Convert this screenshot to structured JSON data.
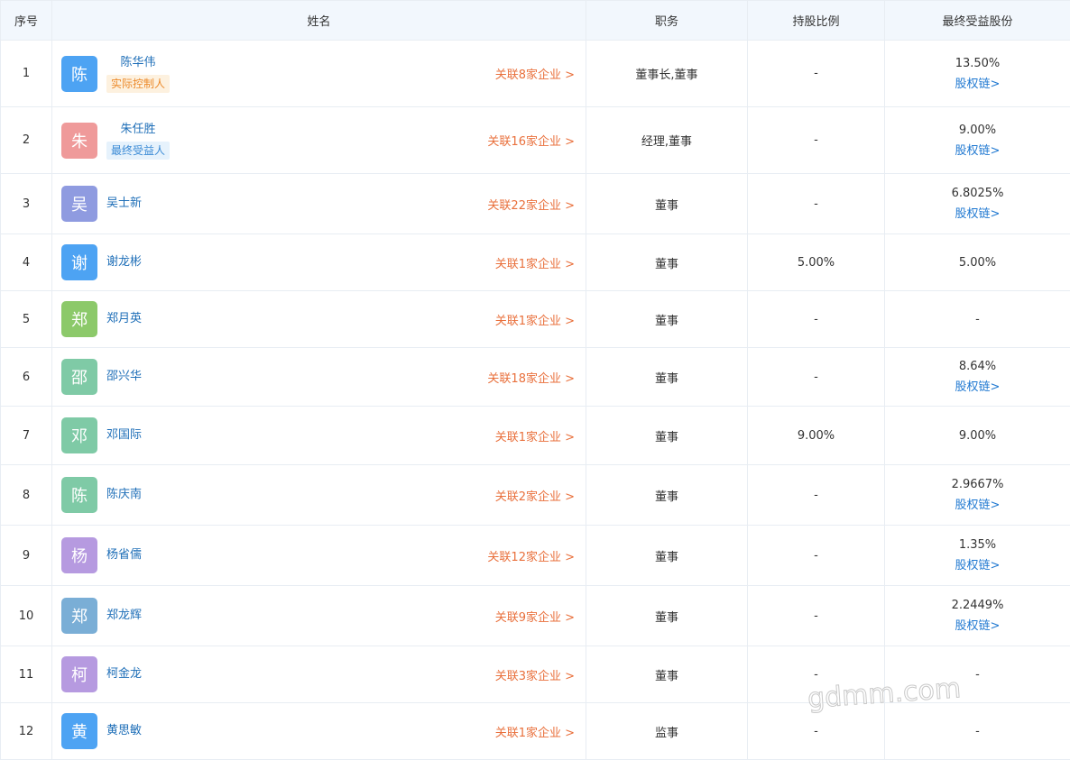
{
  "header": {
    "index": "序号",
    "name": "姓名",
    "position": "职务",
    "share_ratio": "持股比例",
    "ultimate_share": "最终受益股份"
  },
  "rows": [
    {
      "index": "1",
      "avatar_char": "陈",
      "avatar_color": "#4da3f3",
      "name": "陈华伟",
      "tag": "实际控制人",
      "tag_type": "controller",
      "related": "关联8家企业 >",
      "position": "董事长,董事",
      "share_ratio": "-",
      "ultimate_share": "13.50%",
      "chain": "股权链>"
    },
    {
      "index": "2",
      "avatar_char": "朱",
      "avatar_color": "#ef9a9a",
      "name": "朱任胜",
      "tag": "最终受益人",
      "tag_type": "beneficiary",
      "related": "关联16家企业 >",
      "position": "经理,董事",
      "share_ratio": "-",
      "ultimate_share": "9.00%",
      "chain": "股权链>"
    },
    {
      "index": "3",
      "avatar_char": "吴",
      "avatar_color": "#8f9be0",
      "name": "吴士新",
      "tag": "",
      "tag_type": "",
      "related": "关联22家企业 >",
      "position": "董事",
      "share_ratio": "-",
      "ultimate_share": "6.8025%",
      "chain": "股权链>"
    },
    {
      "index": "4",
      "avatar_char": "谢",
      "avatar_color": "#4da3f3",
      "name": "谢龙彬",
      "tag": "",
      "tag_type": "",
      "related": "关联1家企业 >",
      "position": "董事",
      "share_ratio": "5.00%",
      "ultimate_share": "5.00%",
      "chain": ""
    },
    {
      "index": "5",
      "avatar_char": "郑",
      "avatar_color": "#8cc96a",
      "name": "郑月英",
      "tag": "",
      "tag_type": "",
      "related": "关联1家企业 >",
      "position": "董事",
      "share_ratio": "-",
      "ultimate_share": "-",
      "chain": ""
    },
    {
      "index": "6",
      "avatar_char": "邵",
      "avatar_color": "#7fcaa6",
      "name": "邵兴华",
      "tag": "",
      "tag_type": "",
      "related": "关联18家企业 >",
      "position": "董事",
      "share_ratio": "-",
      "ultimate_share": "8.64%",
      "chain": "股权链>"
    },
    {
      "index": "7",
      "avatar_char": "邓",
      "avatar_color": "#7fcaa6",
      "name": "邓国际",
      "tag": "",
      "tag_type": "",
      "related": "关联1家企业 >",
      "position": "董事",
      "share_ratio": "9.00%",
      "ultimate_share": "9.00%",
      "chain": ""
    },
    {
      "index": "8",
      "avatar_char": "陈",
      "avatar_color": "#7fcaa6",
      "name": "陈庆南",
      "tag": "",
      "tag_type": "",
      "related": "关联2家企业 >",
      "position": "董事",
      "share_ratio": "-",
      "ultimate_share": "2.9667%",
      "chain": "股权链>"
    },
    {
      "index": "9",
      "avatar_char": "杨",
      "avatar_color": "#b69ae0",
      "name": "杨省儒",
      "tag": "",
      "tag_type": "",
      "related": "关联12家企业 >",
      "position": "董事",
      "share_ratio": "-",
      "ultimate_share": "1.35%",
      "chain": "股权链>"
    },
    {
      "index": "10",
      "avatar_char": "郑",
      "avatar_color": "#7aaed6",
      "name": "郑龙辉",
      "tag": "",
      "tag_type": "",
      "related": "关联9家企业 >",
      "position": "董事",
      "share_ratio": "-",
      "ultimate_share": "2.2449%",
      "chain": "股权链>"
    },
    {
      "index": "11",
      "avatar_char": "柯",
      "avatar_color": "#b69ae0",
      "name": "柯金龙",
      "tag": "",
      "tag_type": "",
      "related": "关联3家企业 >",
      "position": "董事",
      "share_ratio": "-",
      "ultimate_share": "-",
      "chain": ""
    },
    {
      "index": "12",
      "avatar_char": "黄",
      "avatar_color": "#4da3f3",
      "name": "黄思敏",
      "tag": "",
      "tag_type": "",
      "related": "关联1家企业 >",
      "position": "监事",
      "share_ratio": "-",
      "ultimate_share": "-",
      "chain": ""
    }
  ],
  "watermark": "gdmm.com"
}
